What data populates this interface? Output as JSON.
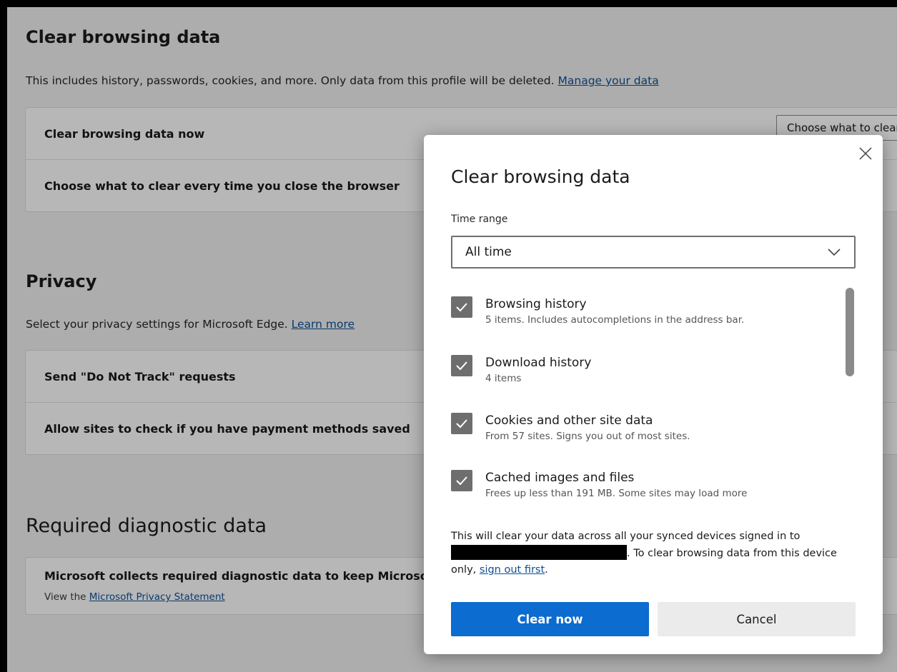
{
  "clear_section": {
    "title": "Clear browsing data",
    "description": "This includes history, passwords, cookies, and more. Only data from this profile will be deleted.",
    "manage_link": "Manage your data",
    "row_now": "Clear browsing data now",
    "row_on_close": "Choose what to clear every time you close the browser",
    "choose_button": "Choose what to clear"
  },
  "privacy_section": {
    "title": "Privacy",
    "description": "Select your privacy settings for Microsoft Edge.",
    "learn_link": "Learn more",
    "row_dnt": "Send \"Do Not Track\" requests",
    "row_payment": "Allow sites to check if you have payment methods saved"
  },
  "diagnostic_section": {
    "title": "Required diagnostic data",
    "row_text": "Microsoft collects required diagnostic data to keep Microsoft Edge secure, up to date and performing as expected",
    "view_prefix": "View the",
    "privacy_link": "Microsoft Privacy Statement"
  },
  "dialog": {
    "title": "Clear browsing data",
    "time_range_label": "Time range",
    "time_range_value": "All time",
    "options": [
      {
        "label": "Browsing history",
        "desc": "5 items. Includes autocompletions in the address bar.",
        "checked": true
      },
      {
        "label": "Download history",
        "desc": "4 items",
        "checked": true
      },
      {
        "label": "Cookies and other site data",
        "desc": "From 57 sites. Signs you out of most sites.",
        "checked": true
      },
      {
        "label": "Cached images and files",
        "desc": "Frees up less than 191 MB. Some sites may load more",
        "checked": true
      }
    ],
    "sync_note_pre": "This will clear your data across all your synced devices signed in to",
    "sync_note_mid": ". To clear browsing data from this device only,",
    "sign_out_link": "sign out first",
    "sync_note_end": ".",
    "clear_button": "Clear now",
    "cancel_button": "Cancel"
  },
  "icons": {
    "close": "close-icon",
    "dropdown": "chevron-down-icon",
    "check": "checkmark-icon"
  },
  "colors": {
    "primary_button": "#0c6ccf",
    "checkbox_fill": "#6e6e6e",
    "link": "#0f4f92"
  }
}
